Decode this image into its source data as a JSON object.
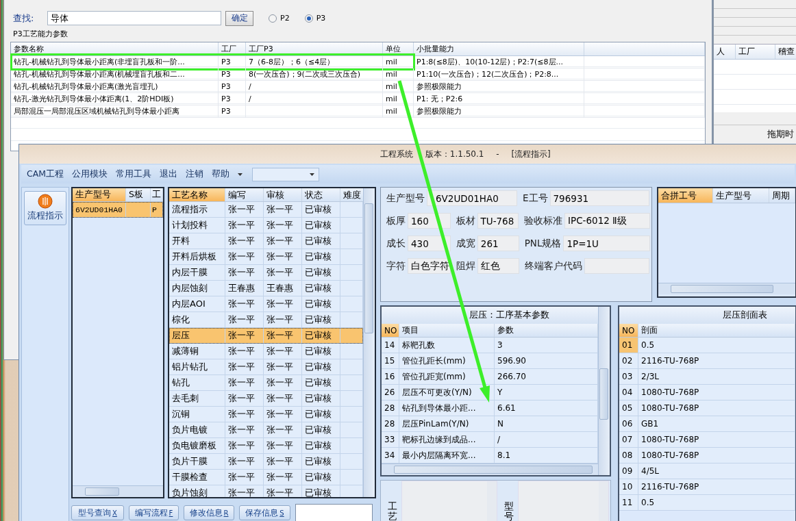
{
  "back_window": {
    "search": {
      "label": "查找:",
      "value": "导体",
      "button": "确定"
    },
    "radios": [
      {
        "label": "P2",
        "selected": false
      },
      {
        "label": "P3",
        "selected": true
      }
    ],
    "group_title": "P3工艺能力参数",
    "table": {
      "columns": [
        "参数名称",
        "工厂",
        "工厂P3",
        "单位",
        "小批量能力"
      ],
      "rows": [
        {
          "name": "钻孔-机械钻孔到导体最小距离(非埋盲孔板和一阶...",
          "factory": "P3",
          "p3": "7（6-8层）；6（≤4层）",
          "unit": "mil",
          "small_batch": "P1:8(≤8层)、10(10-12层)；P2:7(≤8层...",
          "highlighted": true
        },
        {
          "name": "钻孔-机械钻孔到导体最小距离(机械埋盲孔板和二...",
          "factory": "P3",
          "p3": "8(一次压合)；9(二次或三次压合)",
          "unit": "mil",
          "small_batch": "P1:10(一次压合)；12(二次压合)；P2:8...",
          "highlighted": false
        },
        {
          "name": "钻孔-机械钻孔到导体最小距离(激光盲埋孔)",
          "factory": "P3",
          "p3": "/",
          "unit": "mil",
          "small_batch": "参照极限能力",
          "highlighted": false
        },
        {
          "name": "钻孔-激光钻孔到导体最小体距离(1、2阶HDI板)",
          "factory": "P3",
          "p3": "/",
          "unit": "mil",
          "small_batch": "P1: 无；P2:6",
          "highlighted": false
        },
        {
          "name": "局部混压一局部混压区域机械钻孔到导体最小距离",
          "factory": "P3",
          "unit": "mil",
          "small_batch": "参照极限能力",
          "highlighted": false
        }
      ]
    }
  },
  "side_window": {
    "columns": [
      "人",
      "工厂",
      "稽查"
    ],
    "footer_label": "拖期时"
  },
  "main_window": {
    "title": "工程系统 版本：1.1.50.1 - [流程指示]",
    "menu": [
      "CAM工程",
      "公用模块",
      "常用工具",
      "退出",
      "注销",
      "帮助"
    ],
    "sidebar_button": "流程指示",
    "model_table": {
      "columns": [
        "生产型号",
        "S板",
        "工"
      ],
      "rows": [
        {
          "model": "6V2UD01HA0",
          "factory": "P",
          "selected": true
        }
      ]
    },
    "process_table": {
      "columns": [
        "工艺名称",
        "编写",
        "审核",
        "状态",
        "难度"
      ],
      "rows": [
        {
          "name": "流程指示",
          "writer": "张一平",
          "reviewer": "张一平",
          "status": "已审核",
          "selected": false
        },
        {
          "name": "计划投料",
          "writer": "张一平",
          "reviewer": "张一平",
          "status": "已审核",
          "selected": false
        },
        {
          "name": "开料",
          "writer": "张一平",
          "reviewer": "张一平",
          "status": "已审核",
          "selected": false
        },
        {
          "name": "开料后烘板",
          "writer": "张一平",
          "reviewer": "张一平",
          "status": "已审核",
          "selected": false
        },
        {
          "name": "内层干膜",
          "writer": "张一平",
          "reviewer": "张一平",
          "status": "已审核",
          "selected": false
        },
        {
          "name": "内层蚀刻",
          "writer": "王春惠",
          "reviewer": "王春惠",
          "status": "已审核",
          "selected": false
        },
        {
          "name": "内层AOI",
          "writer": "张一平",
          "reviewer": "张一平",
          "status": "已审核",
          "selected": false
        },
        {
          "name": "棕化",
          "writer": "张一平",
          "reviewer": "张一平",
          "status": "已审核",
          "selected": false
        },
        {
          "name": "层压",
          "writer": "张一平",
          "reviewer": "张一平",
          "status": "已审核",
          "selected": true
        },
        {
          "name": "减薄铜",
          "writer": "张一平",
          "reviewer": "张一平",
          "status": "已审核",
          "selected": false
        },
        {
          "name": "铝片钻孔",
          "writer": "张一平",
          "reviewer": "张一平",
          "status": "已审核",
          "selected": false
        },
        {
          "name": "钻孔",
          "writer": "张一平",
          "reviewer": "张一平",
          "status": "已审核",
          "selected": false
        },
        {
          "name": "去毛刺",
          "writer": "张一平",
          "reviewer": "张一平",
          "status": "已审核",
          "selected": false
        },
        {
          "name": "沉铜",
          "writer": "张一平",
          "reviewer": "张一平",
          "status": "已审核",
          "selected": false
        },
        {
          "name": "负片电镀",
          "writer": "张一平",
          "reviewer": "张一平",
          "status": "已审核",
          "selected": false
        },
        {
          "name": "负电镀磨板",
          "writer": "张一平",
          "reviewer": "张一平",
          "status": "已审核",
          "selected": false
        },
        {
          "name": "负片干膜",
          "writer": "张一平",
          "reviewer": "张一平",
          "status": "已审核",
          "selected": false
        },
        {
          "name": "干膜检查",
          "writer": "张一平",
          "reviewer": "张一平",
          "status": "已审核",
          "selected": false
        },
        {
          "name": "负片蚀刻",
          "writer": "张一平",
          "reviewer": "张一平",
          "status": "已审核",
          "selected": false
        }
      ]
    },
    "buttons": [
      {
        "label": "型号查询",
        "shortcut": "X"
      },
      {
        "label": "编写流程",
        "shortcut": "F"
      },
      {
        "label": "修改信息",
        "shortcut": "R"
      },
      {
        "label": "保存信息",
        "shortcut": "S"
      }
    ],
    "info_rows": [
      [
        {
          "label": "生产型号",
          "value": "6V2UD01HA0"
        },
        {
          "label": "E工号",
          "value": "796931"
        }
      ],
      [
        {
          "label": "板厚",
          "value": "160"
        },
        {
          "label": "板材",
          "value": "TU-768"
        },
        {
          "label": "验收标准",
          "value": "IPC-6012 Ⅱ级"
        }
      ],
      [
        {
          "label": "成长",
          "value": "430"
        },
        {
          "label": "成宽",
          "value": "261"
        },
        {
          "label": "PNL规格",
          "value": "1P=1U"
        }
      ],
      [
        {
          "label": "字符",
          "value": "白色字符"
        },
        {
          "label": "阻焊",
          "value": "红色"
        },
        {
          "label": "终端客户代码"
        }
      ]
    ],
    "merge_table": {
      "columns": [
        "合拼工号",
        "生产型号",
        "周期"
      ]
    },
    "param_panel": {
      "title": "层压：工序基本参数",
      "columns": [
        "NO",
        "项目",
        "参数"
      ],
      "rows": [
        [
          "14",
          "标靶孔数",
          "3"
        ],
        [
          "15",
          "管位孔距长(mm)",
          "596.90"
        ],
        [
          "16",
          "管位孔距宽(mm)",
          "266.70"
        ],
        [
          "26",
          "层压不可更改(Y/N)",
          "Y"
        ],
        [
          "28",
          "钻孔到导体最小距...",
          "6.61"
        ],
        [
          "28",
          "层压PinLam(Y/N)",
          "N"
        ],
        [
          "33",
          "靶标孔边缘到成品...",
          "/"
        ],
        [
          "34",
          "最小内层隔离环宽...",
          "8.1"
        ]
      ]
    },
    "notes": [
      {
        "label": "工艺"
      },
      {
        "label": "型号"
      }
    ],
    "lamination": {
      "title": "层压剖面表",
      "columns": [
        "NO",
        "剖面"
      ],
      "rows": [
        {
          "no": "01",
          "layer": "0.5",
          "selected": true
        },
        {
          "no": "02",
          "layer": "2116-TU-768P",
          "selected": false
        },
        {
          "no": "03",
          "layer": "2/3L",
          "selected": false
        },
        {
          "no": "04",
          "layer": "1080-TU-768P",
          "selected": false
        },
        {
          "no": "05",
          "layer": "1080-TU-768P",
          "selected": false
        },
        {
          "no": "06",
          "layer": "GB1",
          "selected": false
        },
        {
          "no": "07",
          "layer": "1080-TU-768P",
          "selected": false
        },
        {
          "no": "08",
          "layer": "1080-TU-768P",
          "selected": false
        },
        {
          "no": "09",
          "layer": "4/5L",
          "selected": false
        },
        {
          "no": "10",
          "layer": "2116-TU-768P",
          "selected": false
        },
        {
          "no": "11",
          "layer": "0.5",
          "selected": false
        }
      ]
    }
  }
}
